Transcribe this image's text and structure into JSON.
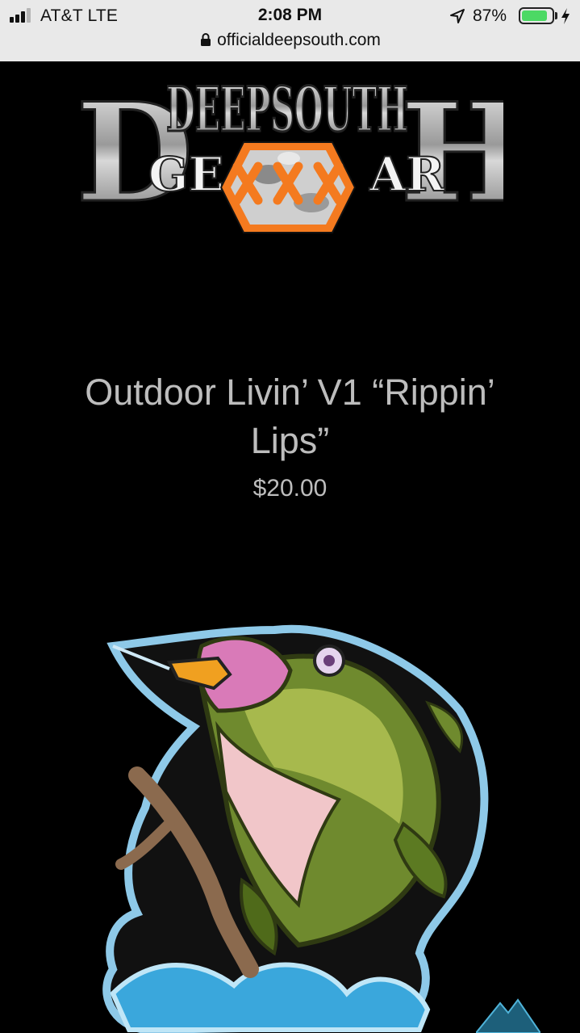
{
  "status_bar": {
    "carrier": "AT&T  LTE",
    "time": "2:08 PM",
    "battery_percent": "87%",
    "battery_level": 0.87,
    "signal_bars": 3,
    "signal_max": 4
  },
  "browser": {
    "url": "officialdeepsouth.com"
  },
  "logo": {
    "top_text": "DEEPSOUTH",
    "bottom_left": "GE",
    "bottom_right": "AR"
  },
  "product": {
    "title_line1": "Outdoor Livin’ V1 “Rippin’",
    "title_line2": "Lips”",
    "price": "$20.00",
    "image_icon": "bass-fish-patch"
  },
  "colors": {
    "background": "#000000",
    "text": "#bdbdbd",
    "accent_orange": "#f47a1f",
    "battery_green": "#4cd964"
  }
}
